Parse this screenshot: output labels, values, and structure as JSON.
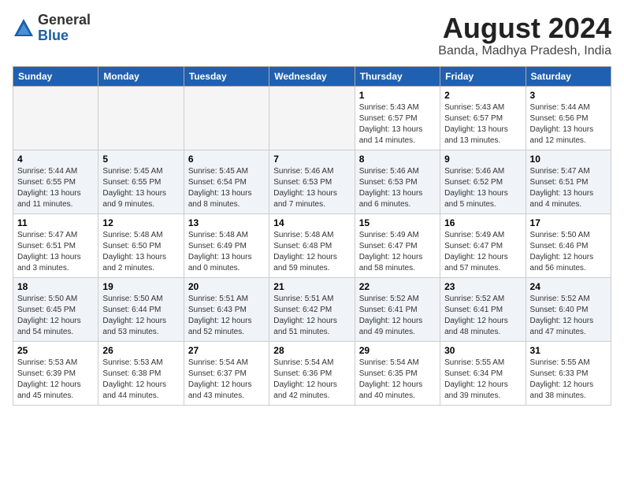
{
  "header": {
    "logo_general": "General",
    "logo_blue": "Blue",
    "month_year": "August 2024",
    "location": "Banda, Madhya Pradesh, India"
  },
  "days_of_week": [
    "Sunday",
    "Monday",
    "Tuesday",
    "Wednesday",
    "Thursday",
    "Friday",
    "Saturday"
  ],
  "weeks": [
    [
      {
        "day": "",
        "info": ""
      },
      {
        "day": "",
        "info": ""
      },
      {
        "day": "",
        "info": ""
      },
      {
        "day": "",
        "info": ""
      },
      {
        "day": "1",
        "info": "Sunrise: 5:43 AM\nSunset: 6:57 PM\nDaylight: 13 hours\nand 14 minutes."
      },
      {
        "day": "2",
        "info": "Sunrise: 5:43 AM\nSunset: 6:57 PM\nDaylight: 13 hours\nand 13 minutes."
      },
      {
        "day": "3",
        "info": "Sunrise: 5:44 AM\nSunset: 6:56 PM\nDaylight: 13 hours\nand 12 minutes."
      }
    ],
    [
      {
        "day": "4",
        "info": "Sunrise: 5:44 AM\nSunset: 6:55 PM\nDaylight: 13 hours\nand 11 minutes."
      },
      {
        "day": "5",
        "info": "Sunrise: 5:45 AM\nSunset: 6:55 PM\nDaylight: 13 hours\nand 9 minutes."
      },
      {
        "day": "6",
        "info": "Sunrise: 5:45 AM\nSunset: 6:54 PM\nDaylight: 13 hours\nand 8 minutes."
      },
      {
        "day": "7",
        "info": "Sunrise: 5:46 AM\nSunset: 6:53 PM\nDaylight: 13 hours\nand 7 minutes."
      },
      {
        "day": "8",
        "info": "Sunrise: 5:46 AM\nSunset: 6:53 PM\nDaylight: 13 hours\nand 6 minutes."
      },
      {
        "day": "9",
        "info": "Sunrise: 5:46 AM\nSunset: 6:52 PM\nDaylight: 13 hours\nand 5 minutes."
      },
      {
        "day": "10",
        "info": "Sunrise: 5:47 AM\nSunset: 6:51 PM\nDaylight: 13 hours\nand 4 minutes."
      }
    ],
    [
      {
        "day": "11",
        "info": "Sunrise: 5:47 AM\nSunset: 6:51 PM\nDaylight: 13 hours\nand 3 minutes."
      },
      {
        "day": "12",
        "info": "Sunrise: 5:48 AM\nSunset: 6:50 PM\nDaylight: 13 hours\nand 2 minutes."
      },
      {
        "day": "13",
        "info": "Sunrise: 5:48 AM\nSunset: 6:49 PM\nDaylight: 13 hours\nand 0 minutes."
      },
      {
        "day": "14",
        "info": "Sunrise: 5:48 AM\nSunset: 6:48 PM\nDaylight: 12 hours\nand 59 minutes."
      },
      {
        "day": "15",
        "info": "Sunrise: 5:49 AM\nSunset: 6:47 PM\nDaylight: 12 hours\nand 58 minutes."
      },
      {
        "day": "16",
        "info": "Sunrise: 5:49 AM\nSunset: 6:47 PM\nDaylight: 12 hours\nand 57 minutes."
      },
      {
        "day": "17",
        "info": "Sunrise: 5:50 AM\nSunset: 6:46 PM\nDaylight: 12 hours\nand 56 minutes."
      }
    ],
    [
      {
        "day": "18",
        "info": "Sunrise: 5:50 AM\nSunset: 6:45 PM\nDaylight: 12 hours\nand 54 minutes."
      },
      {
        "day": "19",
        "info": "Sunrise: 5:50 AM\nSunset: 6:44 PM\nDaylight: 12 hours\nand 53 minutes."
      },
      {
        "day": "20",
        "info": "Sunrise: 5:51 AM\nSunset: 6:43 PM\nDaylight: 12 hours\nand 52 minutes."
      },
      {
        "day": "21",
        "info": "Sunrise: 5:51 AM\nSunset: 6:42 PM\nDaylight: 12 hours\nand 51 minutes."
      },
      {
        "day": "22",
        "info": "Sunrise: 5:52 AM\nSunset: 6:41 PM\nDaylight: 12 hours\nand 49 minutes."
      },
      {
        "day": "23",
        "info": "Sunrise: 5:52 AM\nSunset: 6:41 PM\nDaylight: 12 hours\nand 48 minutes."
      },
      {
        "day": "24",
        "info": "Sunrise: 5:52 AM\nSunset: 6:40 PM\nDaylight: 12 hours\nand 47 minutes."
      }
    ],
    [
      {
        "day": "25",
        "info": "Sunrise: 5:53 AM\nSunset: 6:39 PM\nDaylight: 12 hours\nand 45 minutes."
      },
      {
        "day": "26",
        "info": "Sunrise: 5:53 AM\nSunset: 6:38 PM\nDaylight: 12 hours\nand 44 minutes."
      },
      {
        "day": "27",
        "info": "Sunrise: 5:54 AM\nSunset: 6:37 PM\nDaylight: 12 hours\nand 43 minutes."
      },
      {
        "day": "28",
        "info": "Sunrise: 5:54 AM\nSunset: 6:36 PM\nDaylight: 12 hours\nand 42 minutes."
      },
      {
        "day": "29",
        "info": "Sunrise: 5:54 AM\nSunset: 6:35 PM\nDaylight: 12 hours\nand 40 minutes."
      },
      {
        "day": "30",
        "info": "Sunrise: 5:55 AM\nSunset: 6:34 PM\nDaylight: 12 hours\nand 39 minutes."
      },
      {
        "day": "31",
        "info": "Sunrise: 5:55 AM\nSunset: 6:33 PM\nDaylight: 12 hours\nand 38 minutes."
      }
    ]
  ]
}
